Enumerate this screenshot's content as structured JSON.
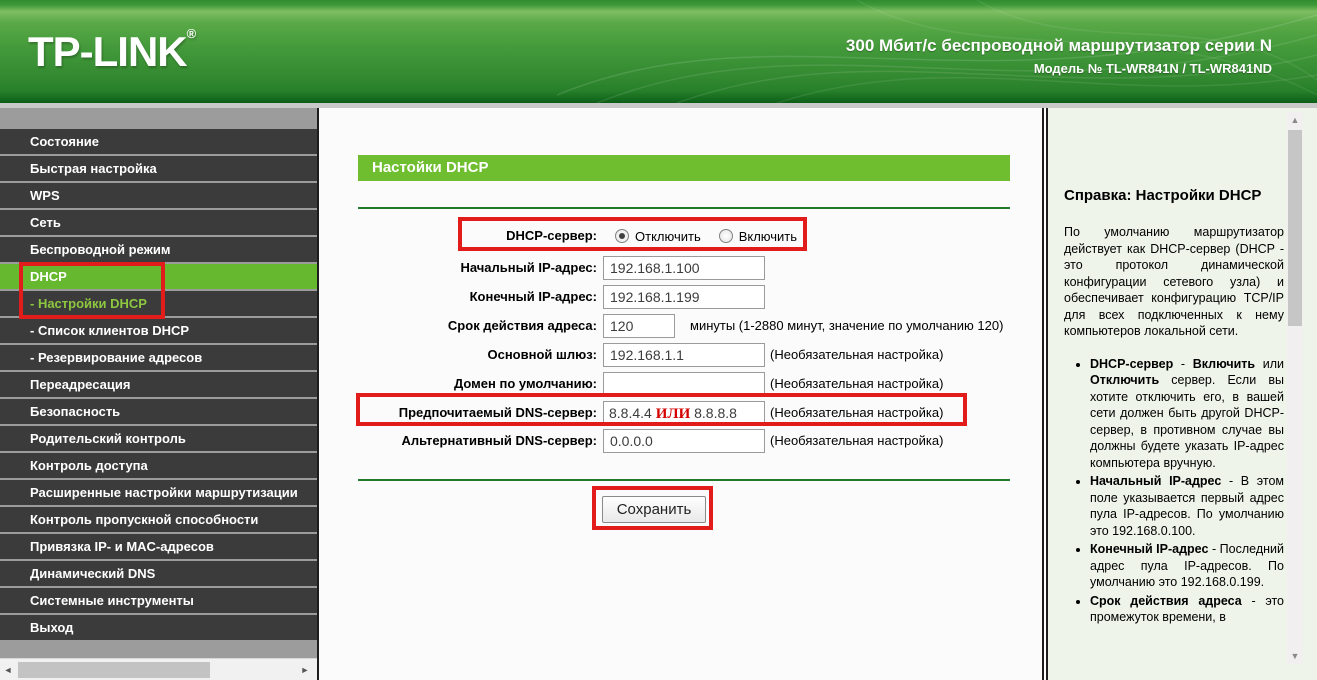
{
  "header": {
    "logo": "TP-LINK",
    "logo_reg": "®",
    "tagline": "300 Мбит/с беспроводной маршрутизатор серии N",
    "model": "Модель № TL-WR841N / TL-WR841ND"
  },
  "colors": {
    "accent_green": "#66b82e",
    "title_bar_green": "#6fbe30",
    "sub_selected_green": "#8dc63f",
    "annotation_red": "#e21b1b",
    "or_red": "#d40000",
    "sidebar_item_bg": "#3b3b3b",
    "help_bg": "#eef4ea"
  },
  "sidebar": {
    "items": [
      {
        "label": "Состояние"
      },
      {
        "label": "Быстрая настройка"
      },
      {
        "label": "WPS"
      },
      {
        "label": "Сеть"
      },
      {
        "label": "Беспроводной режим"
      },
      {
        "label": "DHCP"
      },
      {
        "label": "- Настройки DHCP"
      },
      {
        "label": "- Список клиентов DHCP"
      },
      {
        "label": "- Резервирование адресов"
      },
      {
        "label": "Переадресация"
      },
      {
        "label": "Безопасность"
      },
      {
        "label": "Родительский контроль"
      },
      {
        "label": "Контроль доступа"
      },
      {
        "label": "Расширенные настройки маршрутизации"
      },
      {
        "label": "Контроль пропускной способности"
      },
      {
        "label": "Привязка IP- и MAC-адресов"
      },
      {
        "label": "Динамический DNS"
      },
      {
        "label": "Системные инструменты"
      },
      {
        "label": "Выход"
      }
    ]
  },
  "main": {
    "title": "Настойки DHCP",
    "form": {
      "dhcp_server": {
        "label": "DHCP-сервер:",
        "option_off": "Отключить",
        "option_on": "Включить",
        "selected": "Отключить"
      },
      "start_ip": {
        "label": "Начальный IP-адрес:",
        "value": "192.168.1.100"
      },
      "end_ip": {
        "label": "Конечный IP-адрес:",
        "value": "192.168.1.199"
      },
      "lease": {
        "label": "Срок действия адреса:",
        "value": "120",
        "hint": "минуты (1-2880 минут, значение по умолчанию 120)"
      },
      "gateway": {
        "label": "Основной шлюз:",
        "value": "192.168.1.1",
        "hint": "(Необязательная настройка)"
      },
      "domain": {
        "label": "Домен по умолчанию:",
        "value": "",
        "hint": "(Необязательная настройка)"
      },
      "dns1": {
        "label": "Предпочитаемый DNS-сервер:",
        "value_a": "8.8.4.4",
        "value_or": "ИЛИ",
        "value_b": "8.8.8.8",
        "hint": "(Необязательная настройка)"
      },
      "dns2": {
        "label": "Альтернативный DNS-сервер:",
        "value": "0.0.0.0",
        "hint": "(Необязательная настройка)"
      },
      "save_label": "Сохранить"
    }
  },
  "help": {
    "title": "Справка: Настройки DHCP",
    "intro": "По умолчанию маршрутизатор действует как DHCP-сервер (DHCP - это протокол динамической конфигурации сетевого узла) и обеспечивает конфигурацию TCP/IP для всех подключенных к нему компьютеров локальной сети.",
    "bullets": [
      {
        "segments": [
          {
            "text": "DHCP-сервер"
          },
          {
            "text": " - "
          },
          {
            "text": "Включить"
          },
          {
            "text": " или "
          },
          {
            "text": "Отключить"
          },
          {
            "text": " сервер. Если вы хотите отключить его, в вашей сети должен быть другой DHCP-сервер, в противном случае вы должны будете указать IP-адрес компьютера вручную."
          }
        ]
      },
      {
        "segments": [
          {
            "text": "Начальный IP-адрес"
          },
          {
            "text": " - В этом поле указывается первый адрес пула IP-адресов. По умолчанию это 192.168.0.100."
          }
        ]
      },
      {
        "segments": [
          {
            "text": "Конечный IP-адрес"
          },
          {
            "text": " - Последний адрес пула IP-адресов. По умолчанию это 192.168.0.199."
          }
        ]
      },
      {
        "segments": [
          {
            "text": "Срок действия адреса"
          },
          {
            "text": " - это промежуток времени, в"
          }
        ]
      }
    ]
  }
}
